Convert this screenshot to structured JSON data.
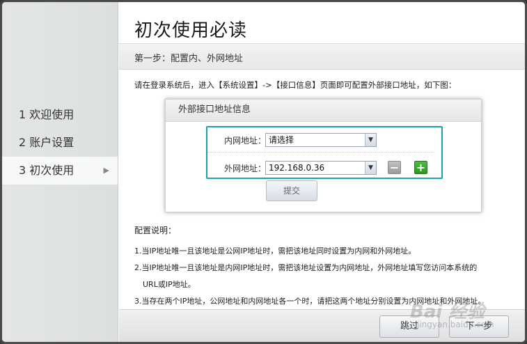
{
  "sidebar": {
    "steps": [
      {
        "label": "1 欢迎使用"
      },
      {
        "label": "2 账户设置"
      },
      {
        "label": "3 初次使用"
      }
    ]
  },
  "main": {
    "title": "初次使用必读",
    "subtitle": "第一步：配置内、外网地址",
    "intro": "请在登录系统后，进入【系统设置】->【接口信息】页面即可配置外部接口地址，如下图：",
    "panel": {
      "title": "外部接口地址信息",
      "lan_label": "内网地址：",
      "lan_value": "请选择",
      "wan_label": "外网地址：",
      "wan_value": "192.168.0.36",
      "submit_label": "提交"
    },
    "notes": {
      "title": "配置说明：",
      "items": [
        "1.当IP地址唯一且该地址是公网IP地址时，需把该地址同时设置为内网和外网地址。",
        "2.当IP地址唯一且该地址是内网IP地址时，需把该地址设置为内网地址，外网地址填写您访问本系统的",
        "URL或IP地址。",
        "3.当存在两个IP地址，公网地址和内网地址各一个时，请把这两个地址分别设置为内网地址和外网地址。"
      ]
    }
  },
  "footer": {
    "skip_label": "跳过",
    "next_label": "下一步"
  },
  "watermark": {
    "text": "Bai 经验",
    "sub": "jingyan.baidu.com"
  },
  "icons": {
    "active_step": "triangle-right-icon",
    "dropdown": "chevron-down-icon",
    "remove": "minus-icon",
    "add": "plus-icon"
  },
  "colors": {
    "highlight": "#1aa0b0",
    "add_button": "#279a1c",
    "remove_button": "#9a9a9a"
  }
}
